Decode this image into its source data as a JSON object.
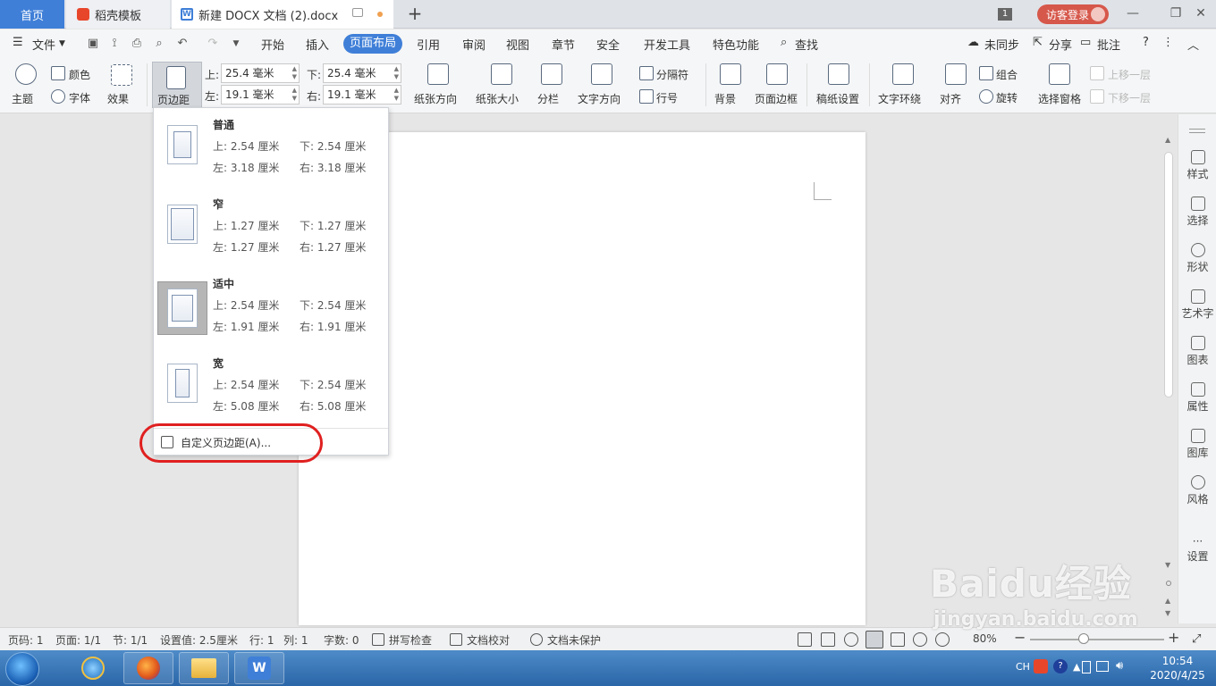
{
  "tabs": {
    "home": "首页",
    "template": "稻壳模板",
    "document": "新建 DOCX 文档 (2).docx",
    "window_count": "1",
    "login": "访客登录"
  },
  "menu": {
    "file": "文件",
    "items": [
      "开始",
      "插入",
      "页面布局",
      "引用",
      "审阅",
      "视图",
      "章节",
      "安全",
      "开发工具",
      "特色功能"
    ],
    "search": "查找",
    "sync": "未同步",
    "share": "分享",
    "comment": "批注"
  },
  "ribbon": {
    "theme": "主题",
    "color": "颜色",
    "font": "字体",
    "effect": "效果",
    "page_margin": "页边距",
    "top_label": "上:",
    "top_value": "25.4 毫米",
    "bottom_label": "下:",
    "bottom_value": "25.4 毫米",
    "left_label": "左:",
    "left_value": "19.1 毫米",
    "right_label": "右:",
    "right_value": "19.1 毫米",
    "orientation": "纸张方向",
    "size": "纸张大小",
    "columns": "分栏",
    "text_direction": "文字方向",
    "separator": "分隔符",
    "line_number": "行号",
    "background": "背景",
    "page_border": "页面边框",
    "manuscript": "稿纸设置",
    "text_wrap": "文字环绕",
    "align": "对齐",
    "group": "组合",
    "rotate": "旋转",
    "selection_pane": "选择窗格",
    "bring_forward": "上移一层",
    "send_backward": "下移一层"
  },
  "margin_dropdown": {
    "options": [
      {
        "name": "普通",
        "top": "上: 2.54 厘米",
        "bottom": "下: 2.54 厘米",
        "left": "左: 3.18 厘米",
        "right": "右: 3.18 厘米"
      },
      {
        "name": "窄",
        "top": "上: 1.27 厘米",
        "bottom": "下: 1.27 厘米",
        "left": "左: 1.27 厘米",
        "right": "右: 1.27 厘米"
      },
      {
        "name": "适中",
        "top": "上: 2.54 厘米",
        "bottom": "下: 2.54 厘米",
        "left": "左: 1.91 厘米",
        "right": "右: 1.91 厘米"
      },
      {
        "name": "宽",
        "top": "上: 2.54 厘米",
        "bottom": "下: 2.54 厘米",
        "left": "左: 5.08 厘米",
        "right": "右: 5.08 厘米"
      }
    ],
    "selected": "适中",
    "custom": "自定义页边距(A)..."
  },
  "right_panel": [
    "样式",
    "选择",
    "形状",
    "艺术字",
    "图表",
    "属性",
    "图库",
    "风格",
    "设置"
  ],
  "status": {
    "page_num": "页码: 1",
    "pages": "页面: 1/1",
    "section": "节: 1/1",
    "setting": "设置值: 2.5厘米",
    "row": "行: 1",
    "col": "列: 1",
    "words": "字数: 0",
    "spell": "拼写检查",
    "proof": "文档校对",
    "protect": "文档未保护",
    "zoom": "80%"
  },
  "taskbar": {
    "lang": "CH",
    "time": "10:54",
    "date": "2020/4/25"
  },
  "watermark": {
    "brand": "Baidu经验",
    "url": "jingyan.baidu.com"
  },
  "colors": {
    "accent": "#3f7fd8",
    "login": "#d6584b",
    "highlight_oval": "#e02020"
  }
}
